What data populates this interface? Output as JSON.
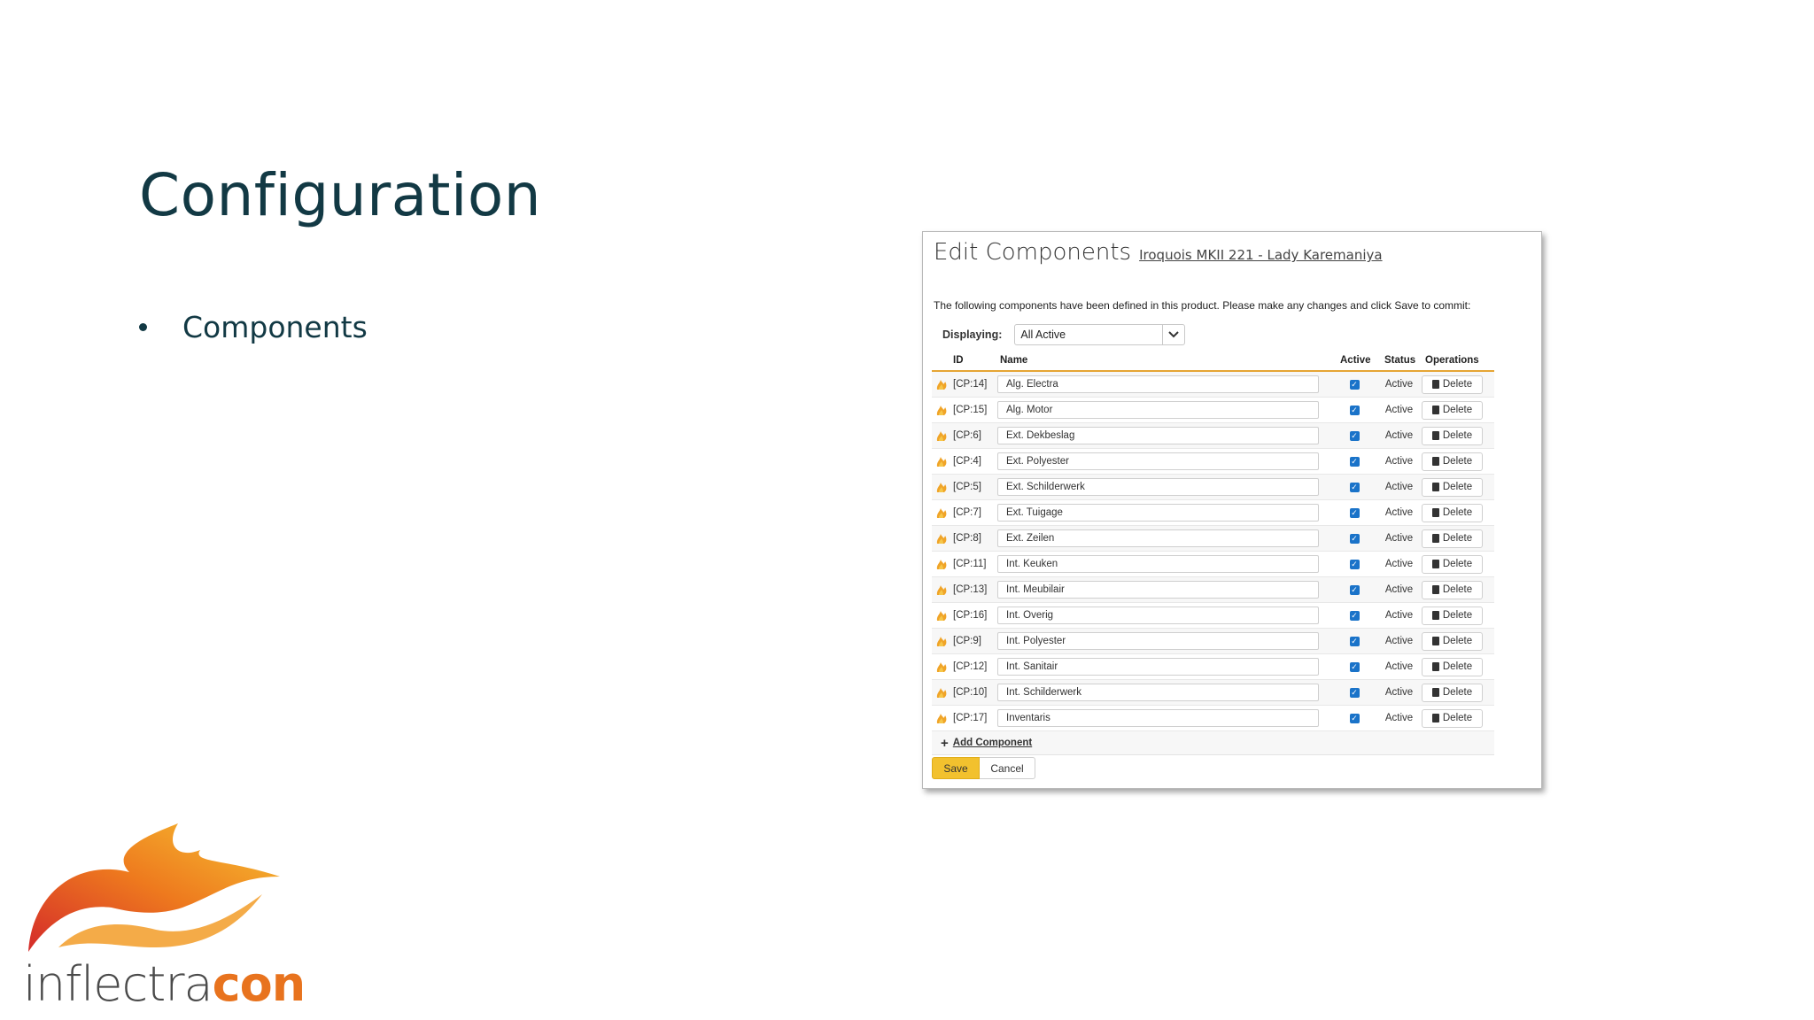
{
  "slide": {
    "title": "Configuration",
    "bullets": [
      "Components"
    ]
  },
  "panel": {
    "title": "Edit Components",
    "product_link": "Iroquois MKII 221 - Lady Karemaniya",
    "intro": "The following components have been defined in this product. Please make any changes and click Save to commit:",
    "displaying_label": "Displaying:",
    "displaying_value": "All Active",
    "columns": {
      "id": "ID",
      "name": "Name",
      "active": "Active",
      "status": "Status",
      "operations": "Operations"
    },
    "rows": [
      {
        "id": "[CP:14]",
        "name": "Alg. Electra",
        "active": true,
        "status": "Active",
        "op": "Delete"
      },
      {
        "id": "[CP:15]",
        "name": "Alg. Motor",
        "active": true,
        "status": "Active",
        "op": "Delete"
      },
      {
        "id": "[CP:6]",
        "name": "Ext. Dekbeslag",
        "active": true,
        "status": "Active",
        "op": "Delete"
      },
      {
        "id": "[CP:4]",
        "name": "Ext. Polyester",
        "active": true,
        "status": "Active",
        "op": "Delete"
      },
      {
        "id": "[CP:5]",
        "name": "Ext. Schilderwerk",
        "active": true,
        "status": "Active",
        "op": "Delete"
      },
      {
        "id": "[CP:7]",
        "name": "Ext. Tuigage",
        "active": true,
        "status": "Active",
        "op": "Delete"
      },
      {
        "id": "[CP:8]",
        "name": "Ext. Zeilen",
        "active": true,
        "status": "Active",
        "op": "Delete"
      },
      {
        "id": "[CP:11]",
        "name": "Int. Keuken",
        "active": true,
        "status": "Active",
        "op": "Delete"
      },
      {
        "id": "[CP:13]",
        "name": "Int. Meubilair",
        "active": true,
        "status": "Active",
        "op": "Delete"
      },
      {
        "id": "[CP:16]",
        "name": "Int. Overig",
        "active": true,
        "status": "Active",
        "op": "Delete"
      },
      {
        "id": "[CP:9]",
        "name": "Int. Polyester",
        "active": true,
        "status": "Active",
        "op": "Delete"
      },
      {
        "id": "[CP:12]",
        "name": "Int. Sanitair",
        "active": true,
        "status": "Active",
        "op": "Delete"
      },
      {
        "id": "[CP:10]",
        "name": "Int. Schilderwerk",
        "active": true,
        "status": "Active",
        "op": "Delete"
      },
      {
        "id": "[CP:17]",
        "name": "Inventaris",
        "active": true,
        "status": "Active",
        "op": "Delete"
      }
    ],
    "add_component": "Add Component",
    "save": "Save",
    "cancel": "Cancel"
  },
  "logo": {
    "part1": "inflectra",
    "part2": "con"
  },
  "colors": {
    "title": "#123944",
    "accent": "#e6a534",
    "save": "#f2c12e",
    "checkbox": "#1a73c9",
    "logo_orange": "#e8731e"
  },
  "icons": {
    "component": "flame-icon",
    "delete": "trash-icon",
    "dropdown": "chevron-down-icon",
    "add": "plus-icon"
  }
}
